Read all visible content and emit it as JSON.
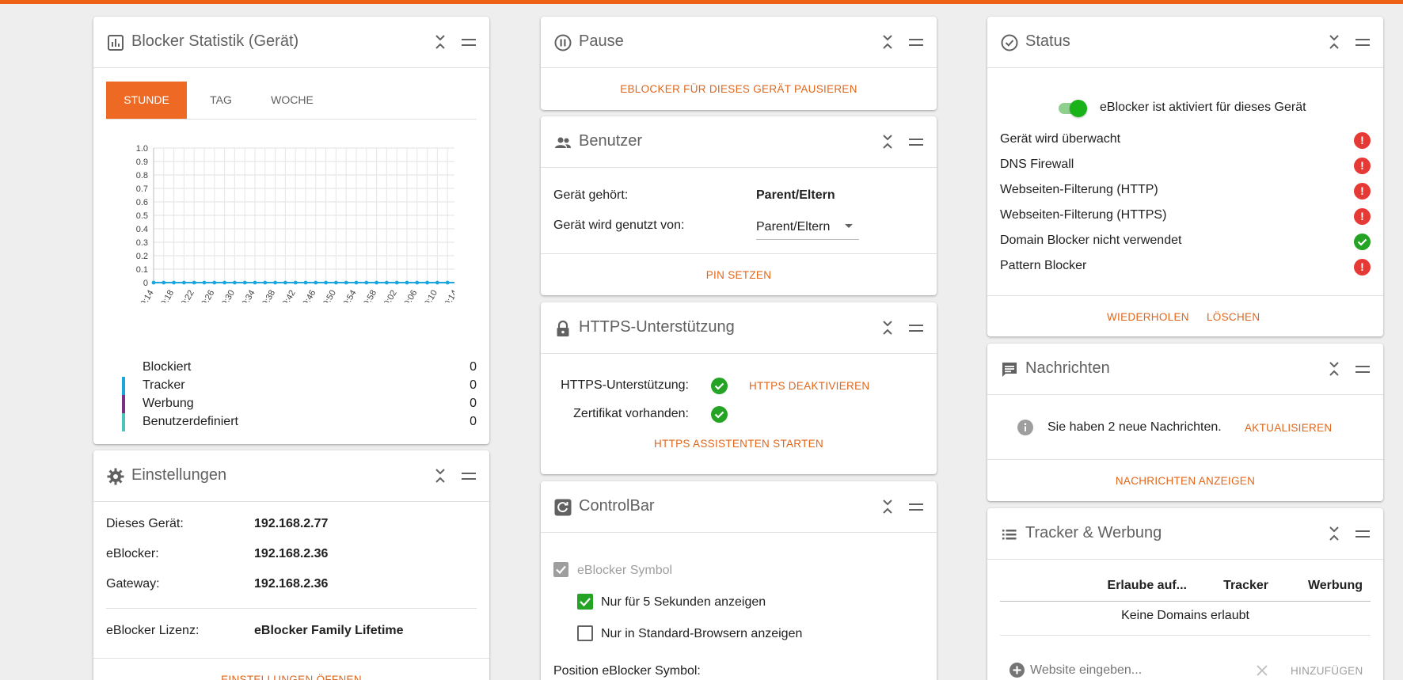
{
  "colors": {
    "accent": "#ee6115",
    "link": "#e0661b",
    "ok": "#25a325",
    "error": "#e53935",
    "tracker": "#1ba6e0",
    "ads": "#7b2f85",
    "custom": "#4fc3b8",
    "line": "#1ba6e0"
  },
  "stats": {
    "title": "Blocker Statistik (Gerät)",
    "tabs": [
      "STUNDE",
      "TAG",
      "WOCHE"
    ],
    "legend": [
      {
        "label": "Blockiert",
        "value": "0"
      },
      {
        "label": "Tracker",
        "value": "0"
      },
      {
        "label": "Werbung",
        "value": "0"
      },
      {
        "label": "Benutzerdefiniert",
        "value": "0"
      }
    ]
  },
  "chart_data": {
    "type": "line",
    "title": "",
    "xlabel": "",
    "ylabel": "",
    "ylim": [
      0,
      1.0
    ],
    "yticks": [
      "0",
      "0.1",
      "0.2",
      "0.3",
      "0.4",
      "0.5",
      "0.6",
      "0.7",
      "0.8",
      "0.9",
      "1.0"
    ],
    "xticks": [
      "19:14",
      "19:18",
      "19:22",
      "19:26",
      "19:30",
      "19:34",
      "19:38",
      "19:42",
      "19:46",
      "19:50",
      "19:54",
      "19:58",
      "20:02",
      "20:06",
      "20:10",
      "20:14"
    ],
    "x": [
      "19:14",
      "19:16",
      "19:18",
      "19:20",
      "19:22",
      "19:24",
      "19:26",
      "19:28",
      "19:30",
      "19:32",
      "19:34",
      "19:36",
      "19:38",
      "19:40",
      "19:42",
      "19:44",
      "19:46",
      "19:48",
      "19:50",
      "19:52",
      "19:54",
      "19:56",
      "19:58",
      "20:00",
      "20:02",
      "20:04",
      "20:06",
      "20:08",
      "20:10",
      "20:12",
      "20:14"
    ],
    "series": [
      {
        "values": [
          0,
          0,
          0,
          0,
          0,
          0,
          0,
          0,
          0,
          0,
          0,
          0,
          0,
          0,
          0,
          0,
          0,
          0,
          0,
          0,
          0,
          0,
          0,
          0,
          0,
          0,
          0,
          0,
          0,
          0,
          0
        ]
      }
    ],
    "grid": true
  },
  "settings": {
    "title": "Einstellungen",
    "rows": [
      {
        "label": "Dieses Gerät:",
        "value": "192.168.2.77"
      },
      {
        "label": "eBlocker:",
        "value": "192.168.2.36"
      },
      {
        "label": "Gateway:",
        "value": "192.168.2.36"
      }
    ],
    "license_label": "eBlocker Lizenz:",
    "license_value": "eBlocker Family Lifetime",
    "open_link": "EINSTELLUNGEN ÖFFNEN"
  },
  "pause": {
    "title": "Pause",
    "link": "EBLOCKER FÜR DIESES GERÄT PAUSIEREN"
  },
  "users": {
    "title": "Benutzer",
    "owner_label": "Gerät gehört:",
    "owner_value": "Parent/Eltern",
    "used_label": "Gerät wird genutzt von:",
    "used_value": "Parent/Eltern",
    "pin_link": "PIN SETZEN"
  },
  "https": {
    "title": "HTTPS-Unterstützung",
    "support_label": "HTTPS-Unterstützung:",
    "deactivate_link": "HTTPS DEAKTIVIEREN",
    "cert_label": "Zertifikat vorhanden:",
    "wizard_link": "HTTPS ASSISTENTEN STARTEN"
  },
  "controlbar": {
    "title": "ControlBar",
    "symbol_label": "eBlocker Symbol",
    "opt1": "Nur für 5 Sekunden anzeigen",
    "opt2": "Nur in Standard-Browsern anzeigen",
    "position_label": "Position eBlocker Symbol:"
  },
  "status": {
    "title": "Status",
    "toggle_label": "eBlocker ist aktiviert für dieses Gerät",
    "items": [
      {
        "label": "Gerät wird überwacht",
        "state": "error"
      },
      {
        "label": "DNS Firewall",
        "state": "error"
      },
      {
        "label": "Webseiten-Filterung (HTTP)",
        "state": "error"
      },
      {
        "label": "Webseiten-Filterung (HTTPS)",
        "state": "error"
      },
      {
        "label": "Domain Blocker nicht verwendet",
        "state": "ok"
      },
      {
        "label": "Pattern Blocker",
        "state": "error"
      }
    ],
    "retry_link": "WIEDERHOLEN",
    "delete_link": "LÖSCHEN"
  },
  "messages": {
    "title": "Nachrichten",
    "text": "Sie haben 2 neue Nachrichten.",
    "refresh_link": "AKTUALISIEREN",
    "show_link": "NACHRICHTEN ANZEIGEN"
  },
  "tracker": {
    "title": "Tracker & Werbung",
    "columns": [
      "Erlaube auf...",
      "Tracker",
      "Werbung"
    ],
    "empty": "Keine Domains erlaubt",
    "placeholder": "Website eingeben...",
    "add_link": "HINZUFÜGEN"
  }
}
